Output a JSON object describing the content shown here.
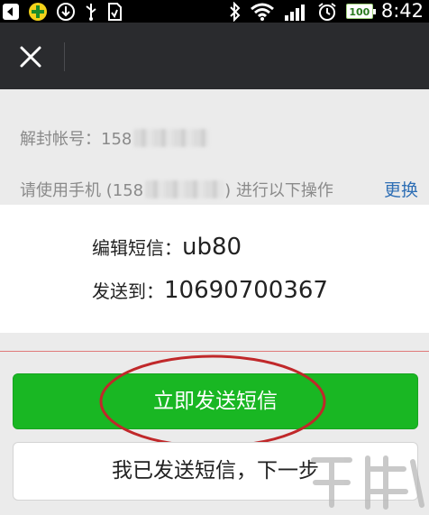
{
  "status_bar": {
    "time": "8:42",
    "battery_level": "100",
    "icons": [
      "back-icon",
      "security-app-icon",
      "download-icon",
      "usb-icon",
      "sd-card-icon",
      "bluetooth-icon",
      "wifi-icon",
      "signal-icon",
      "alarm-icon",
      "battery-icon"
    ]
  },
  "title_bar": {
    "close_icon": "close-icon"
  },
  "info": {
    "account_label": "解封帐号：158",
    "phone_prefix": "请使用手机 (158",
    "phone_suffix": ") 进行以下操作",
    "change_link": "更换"
  },
  "sms": {
    "edit_label": "编辑短信：",
    "edit_value": "ub80",
    "send_to_label": "发送到：",
    "send_to_value": "10690700367"
  },
  "actions": {
    "send_now": "立即发送短信",
    "sent_next": "我已发送短信，下一步"
  },
  "colors": {
    "title_bar": "#2a2b2e",
    "primary_button": "#19b723",
    "link": "#2f6fb5",
    "highlight": "#c0282a"
  }
}
